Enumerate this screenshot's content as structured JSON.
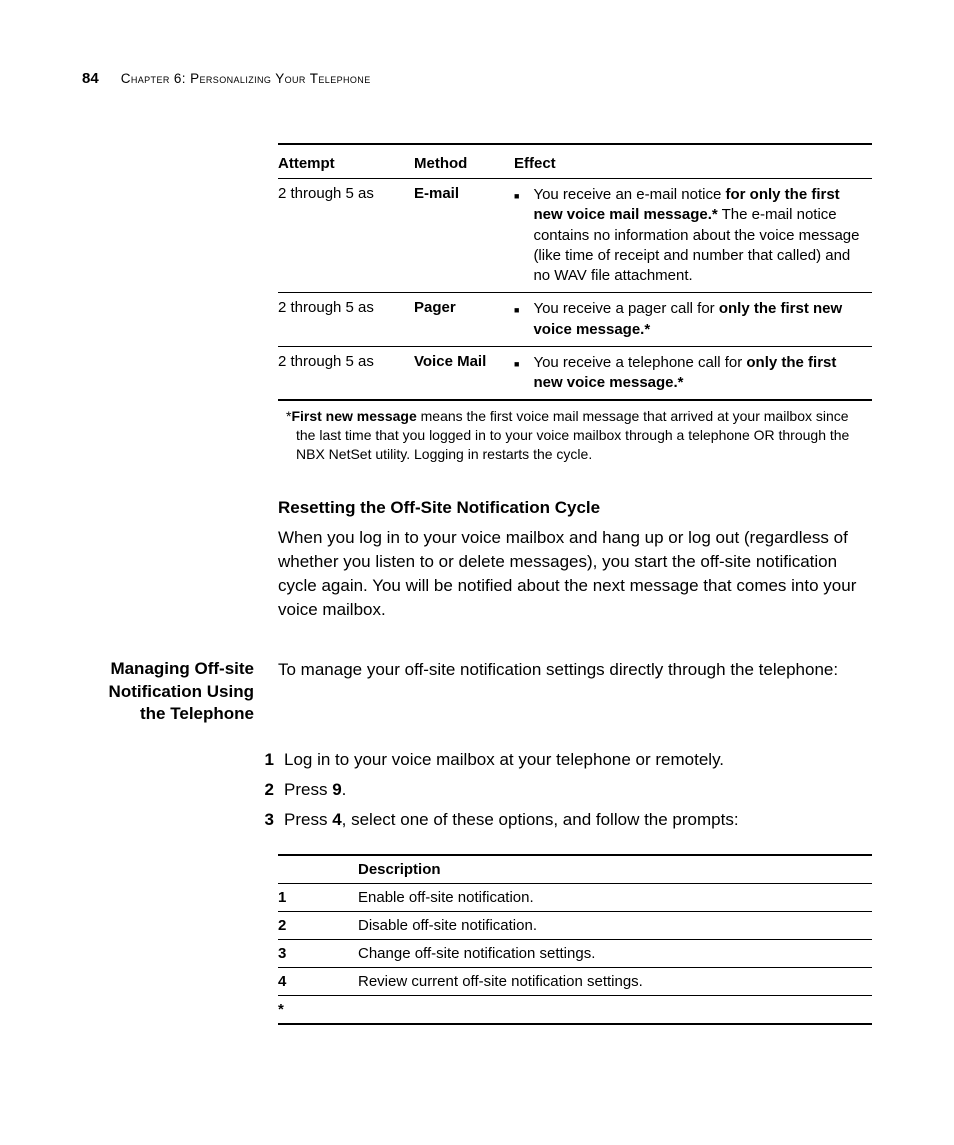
{
  "header": {
    "page_number": "84",
    "chapter_label": "Chapter 6: Personalizing Your Telephone"
  },
  "table1": {
    "headers": {
      "attempt": "Attempt",
      "method": "Method",
      "effect": "Effect"
    },
    "rows": [
      {
        "attempt": "2 through 5 as",
        "method": "E-mail",
        "effect_pre": "You receive an e-mail notice ",
        "effect_bold": "for only the first new voice mail message.*",
        "effect_post": " The e-mail notice contains no information about the voice message (like time of receipt and number that called) and no WAV file attachment."
      },
      {
        "attempt": "2 through 5 as",
        "method": "Pager",
        "effect_pre": "You receive a pager call for ",
        "effect_bold": "only the first new voice message.*",
        "effect_post": ""
      },
      {
        "attempt": "2 through 5 as",
        "method": "Voice Mail",
        "effect_pre": "You receive a telephone call for ",
        "effect_bold": "only the first new voice message.*",
        "effect_post": ""
      }
    ],
    "footnote_star": "*",
    "footnote_bold": "First new message",
    "footnote_rest": " means the first voice mail message that arrived at your mailbox since the last time that you logged in to your voice mailbox through a telephone OR through the NBX NetSet utility. Logging in restarts the cycle."
  },
  "subheading": "Resetting the Off-Site Notification Cycle",
  "paragraph1": "When you log in to your voice mailbox and hang up or log out (regardless of whether you listen to or delete messages), you start the off-site notification cycle again. You will be notified about the next message that comes into your voice mailbox.",
  "side_heading": "Managing Off-site Notification Using the Telephone",
  "side_intro": "To manage your off-site notification settings directly through the telephone:",
  "steps": [
    {
      "n": "1",
      "text_pre": "Log in to your voice mailbox at your telephone or remotely.",
      "bold": "",
      "text_post": ""
    },
    {
      "n": "2",
      "text_pre": "Press ",
      "bold": "9",
      "text_post": "."
    },
    {
      "n": "3",
      "text_pre": "Press ",
      "bold": "4",
      "text_post": ", select one of these options, and follow the prompts:"
    }
  ],
  "table2": {
    "header_desc": "Description",
    "rows": [
      {
        "key": "1",
        "desc": "Enable off-site notification."
      },
      {
        "key": "2",
        "desc": "Disable off-site notification."
      },
      {
        "key": "3",
        "desc": "Change off-site notification settings."
      },
      {
        "key": "4",
        "desc": "Review current off-site notification settings."
      },
      {
        "key": "*",
        "desc": ""
      }
    ]
  }
}
